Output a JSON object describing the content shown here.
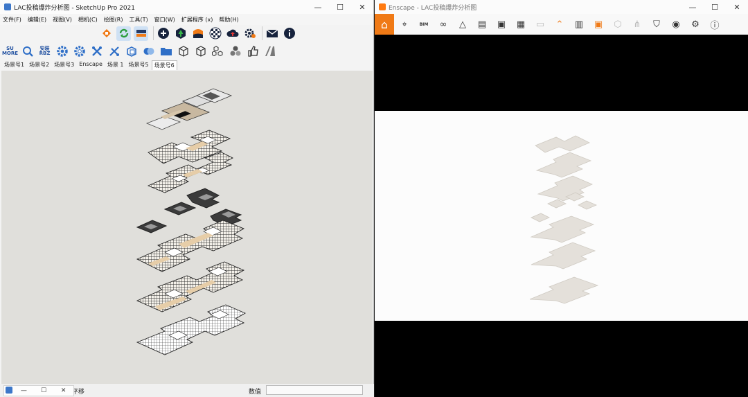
{
  "sketchup": {
    "title": "LAC投稿爆炸分析图 - SketchUp Pro 2021",
    "menus": [
      "文件(F)",
      "编辑(E)",
      "视图(V)",
      "相机(C)",
      "绘图(R)",
      "工具(T)",
      "窗口(W)",
      "扩展程序 (x)",
      "帮助(H)"
    ],
    "toolbar2_labels": {
      "su_more": "SU MORE",
      "install_rbz": "安装 RBZ"
    },
    "scene_tabs": [
      "场景号1",
      "场景号2",
      "场景号3",
      "Enscape",
      "场景 1",
      "场景号5",
      "场景号6"
    ],
    "active_scene": "场景号6",
    "status_hint": "平移",
    "measure_label": "数值",
    "window_buttons": {
      "minimize": "—",
      "maximize": "☐",
      "close": "✕"
    }
  },
  "enscape": {
    "title": "Enscape - LAC投稿爆炸分析图",
    "bim_label": "BIM",
    "window_buttons": {
      "minimize": "—",
      "maximize": "☐",
      "close": "✕"
    }
  },
  "mini_window": {
    "minimize": "—",
    "maximize": "☐",
    "close": "✕"
  },
  "colors": {
    "enscape_orange": "#f07a16",
    "viewport_bg": "#e0dfdb",
    "su_blue": "#1f4fa0"
  }
}
